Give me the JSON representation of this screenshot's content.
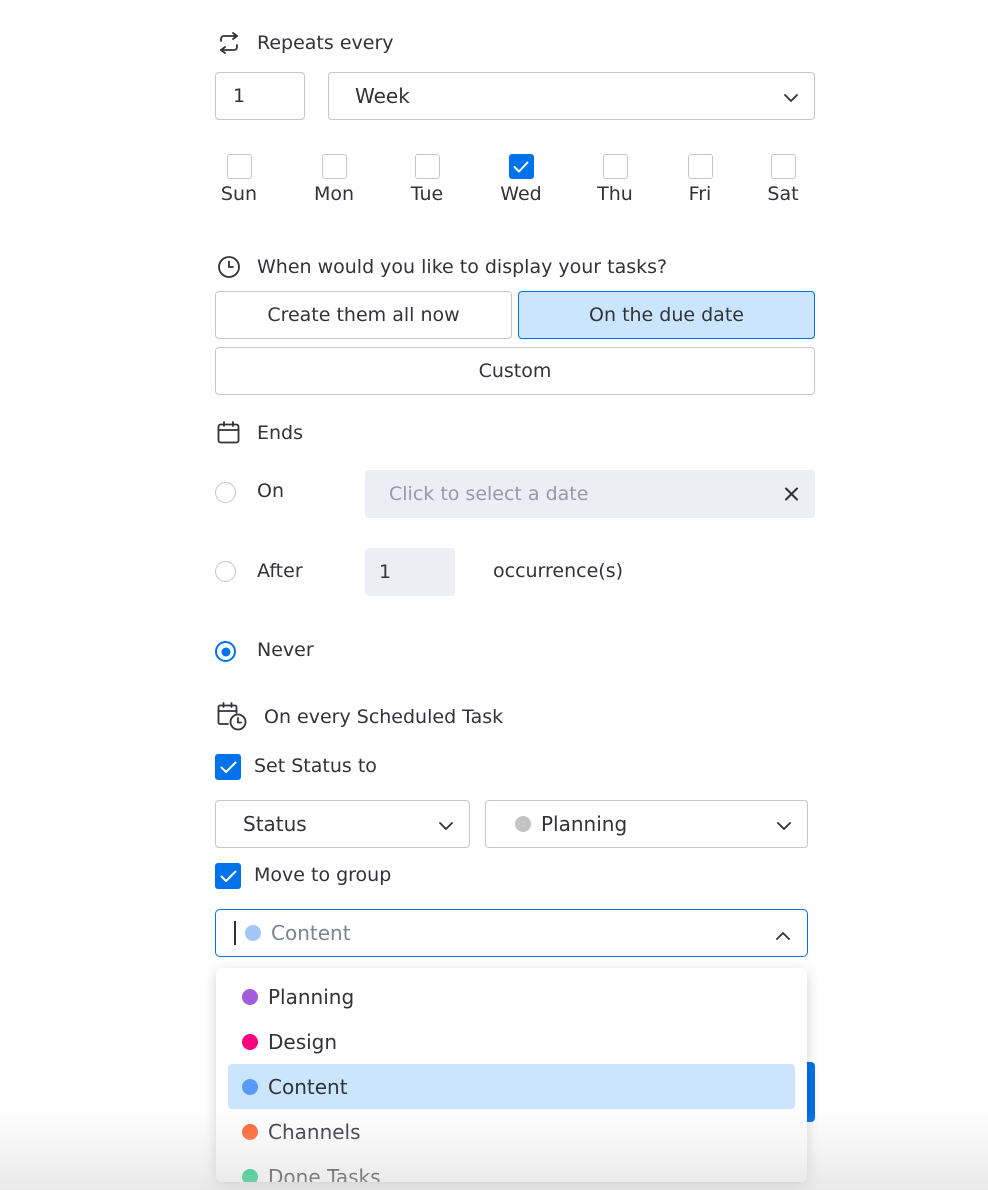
{
  "repeats": {
    "title": "Repeats every",
    "interval_value": "1",
    "unit": "Week",
    "days": [
      {
        "label": "Sun",
        "checked": false
      },
      {
        "label": "Mon",
        "checked": false
      },
      {
        "label": "Tue",
        "checked": false
      },
      {
        "label": "Wed",
        "checked": true
      },
      {
        "label": "Thu",
        "checked": false
      },
      {
        "label": "Fri",
        "checked": false
      },
      {
        "label": "Sat",
        "checked": false
      }
    ]
  },
  "display": {
    "title": "When would you like to display your tasks?",
    "options": [
      {
        "label": "Create them all now",
        "selected": false
      },
      {
        "label": "On the due date",
        "selected": true
      },
      {
        "label": "Custom",
        "selected": false
      }
    ]
  },
  "ends": {
    "title": "Ends",
    "on_label": "On",
    "date_placeholder": "Click to select a date",
    "after_label": "After",
    "occurrences_value": "1",
    "occurrences_suffix": "occurrence(s)",
    "never_label": "Never",
    "selected": "Never"
  },
  "scheduled": {
    "title": "On every Scheduled Task",
    "set_status_label": "Set Status to",
    "status_column": "Status",
    "status_value": "Planning",
    "status_value_color": "#c4c4c4",
    "move_group_label": "Move to group",
    "group_value": "Content",
    "group_value_color": "#a1c6f7"
  },
  "group_menu": {
    "items": [
      {
        "label": "Planning",
        "color": "#a25ddc",
        "active": false
      },
      {
        "label": "Design",
        "color": "#ff007f",
        "active": false
      },
      {
        "label": "Content",
        "color": "#579bfc",
        "active": true
      },
      {
        "label": "Channels",
        "color": "#ff642e",
        "active": false
      },
      {
        "label": "Done Tasks",
        "color": "#00c875",
        "active": false
      }
    ]
  },
  "colors": {
    "accent": "#0073ea",
    "selected_bg": "#cce5ff"
  }
}
